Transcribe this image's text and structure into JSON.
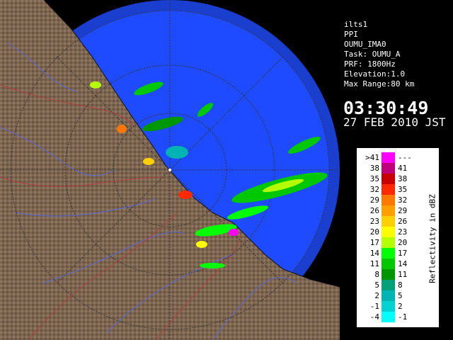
{
  "info": {
    "lines": [
      "ilts1",
      "PPI",
      "OUMU_IMA0",
      "Task: OUMU_A",
      "PRF: 1800Hz",
      "Elevation:1.0",
      "Max Range:80 km"
    ],
    "time": "03:30:49",
    "date": "27 FEB 2010 JST"
  },
  "legend": {
    "title": "Reflectivity in dBZ",
    "rows": [
      {
        "lower": ">41",
        "upper": "---",
        "color": "#ff00ff"
      },
      {
        "lower": "38",
        "upper": "41",
        "color": "#c00078"
      },
      {
        "lower": "35",
        "upper": "38",
        "color": "#c80000"
      },
      {
        "lower": "32",
        "upper": "35",
        "color": "#ff2800"
      },
      {
        "lower": "29",
        "upper": "32",
        "color": "#ff7800"
      },
      {
        "lower": "26",
        "upper": "29",
        "color": "#ffa000"
      },
      {
        "lower": "23",
        "upper": "26",
        "color": "#ffd000"
      },
      {
        "lower": "20",
        "upper": "23",
        "color": "#ffff00"
      },
      {
        "lower": "17",
        "upper": "20",
        "color": "#b4ff00"
      },
      {
        "lower": "14",
        "upper": "17",
        "color": "#00ff00"
      },
      {
        "lower": "11",
        "upper": "14",
        "color": "#00c800"
      },
      {
        "lower": "8",
        "upper": "11",
        "color": "#009600"
      },
      {
        "lower": "5",
        "upper": "8",
        "color": "#00a078"
      },
      {
        "lower": "2",
        "upper": "5",
        "color": "#00b4b4"
      },
      {
        "lower": "-1",
        "upper": "2",
        "color": "#00d2d2"
      },
      {
        "lower": "-4",
        "upper": "-1",
        "color": "#00ffff"
      }
    ]
  },
  "colors": {
    "sea": "#1e4bff",
    "sea_far": "#1a3fcf",
    "land": "#7d6550",
    "rivers": "#5a6ad8",
    "borders": "#b04040",
    "range_rings": "#333333"
  },
  "map_icons": [
    "radar-site-icon"
  ]
}
